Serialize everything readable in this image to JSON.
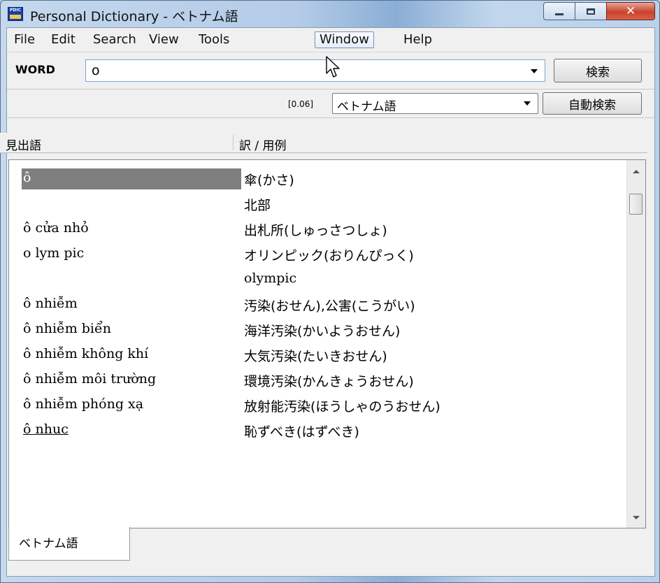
{
  "window": {
    "title": "Personal Dictionary - ベトナム語",
    "app_icon_text": "PDIC"
  },
  "menu": [
    "File",
    "Edit",
    "Search",
    "View",
    "Tools",
    "Window",
    "Help"
  ],
  "word_bar": {
    "label": "WORD",
    "value": "o",
    "search_button": "検索"
  },
  "status_bar": {
    "time": "[0.06]",
    "dictionary": "ベトナム語",
    "auto_search_button": "自動検索"
  },
  "columns": {
    "headword": "見出語",
    "translation": "訳 / 用例"
  },
  "entries": [
    {
      "headword": "ô",
      "translation": "傘(かさ)"
    },
    {
      "headword": "",
      "translation": "北部"
    },
    {
      "headword": "ô cửa nhỏ",
      "translation": "出札所(しゅっさつしょ)"
    },
    {
      "headword": "o lym pic",
      "translation": "オリンピック(おりんぴっく)"
    },
    {
      "headword": "",
      "translation": "olympic"
    },
    {
      "headword": "ô nhiễm",
      "translation": "汚染(おせん),公害(こうがい)"
    },
    {
      "headword": "ô nhiễm biển",
      "translation": "海洋汚染(かいようおせん)"
    },
    {
      "headword": "ô nhiễm không khí",
      "translation": "大気汚染(たいきおせん)"
    },
    {
      "headword": "ô nhiễm môi trường",
      "translation": "環境汚染(かんきょうおせん)"
    },
    {
      "headword": "ô nhiễm phóng xạ",
      "translation": "放射能汚染(ほうしゃのうおせん)"
    },
    {
      "headword": "ô nhuc",
      "translation": "恥ずべき(はずべき)"
    }
  ],
  "tabs": [
    "ベトナム語"
  ]
}
